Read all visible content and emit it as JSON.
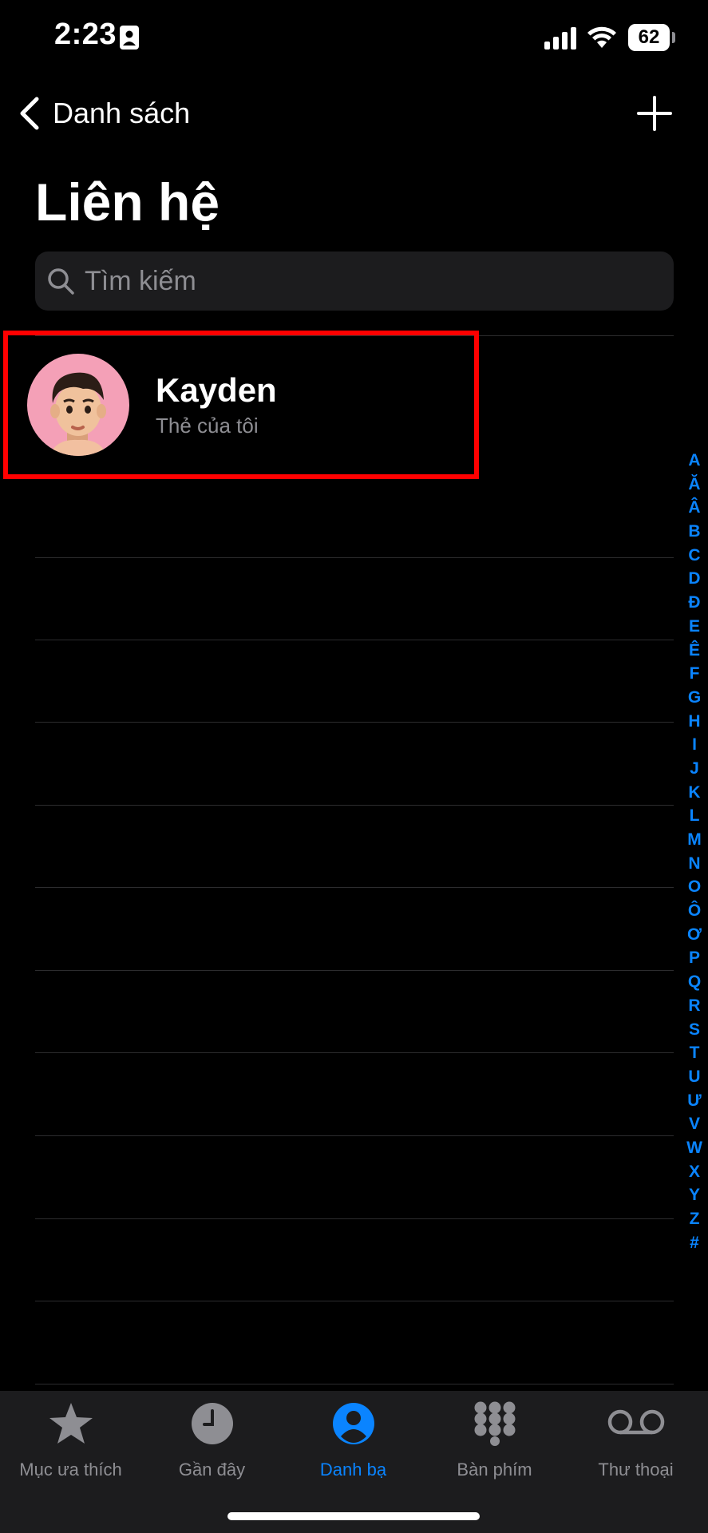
{
  "status_bar": {
    "time": "2:23",
    "battery": "62"
  },
  "nav": {
    "back_label": "Danh sách",
    "title": "Liên hệ"
  },
  "search": {
    "placeholder": "Tìm kiếm",
    "value": ""
  },
  "my_card": {
    "name": "Kayden",
    "subtitle": "Thẻ của tôi"
  },
  "index_letters": [
    "A",
    "Ă",
    "Â",
    "B",
    "C",
    "D",
    "Đ",
    "E",
    "Ê",
    "F",
    "G",
    "H",
    "I",
    "J",
    "K",
    "L",
    "M",
    "N",
    "O",
    "Ô",
    "Ơ",
    "P",
    "Q",
    "R",
    "S",
    "T",
    "U",
    "Ư",
    "V",
    "W",
    "X",
    "Y",
    "Z",
    "#"
  ],
  "tabs": [
    {
      "label": "Mục ưa thích",
      "icon": "star-icon",
      "active": false
    },
    {
      "label": "Gần đây",
      "icon": "clock-icon",
      "active": false
    },
    {
      "label": "Danh bạ",
      "icon": "person-circle-icon",
      "active": true
    },
    {
      "label": "Bàn phím",
      "icon": "keypad-icon",
      "active": false
    },
    {
      "label": "Thư thoại",
      "icon": "voicemail-icon",
      "active": false
    }
  ],
  "colors": {
    "accent": "#0a84ff",
    "background": "#000000",
    "card_highlight": "#ff0000",
    "avatar_bg": "#f4a0b7"
  }
}
